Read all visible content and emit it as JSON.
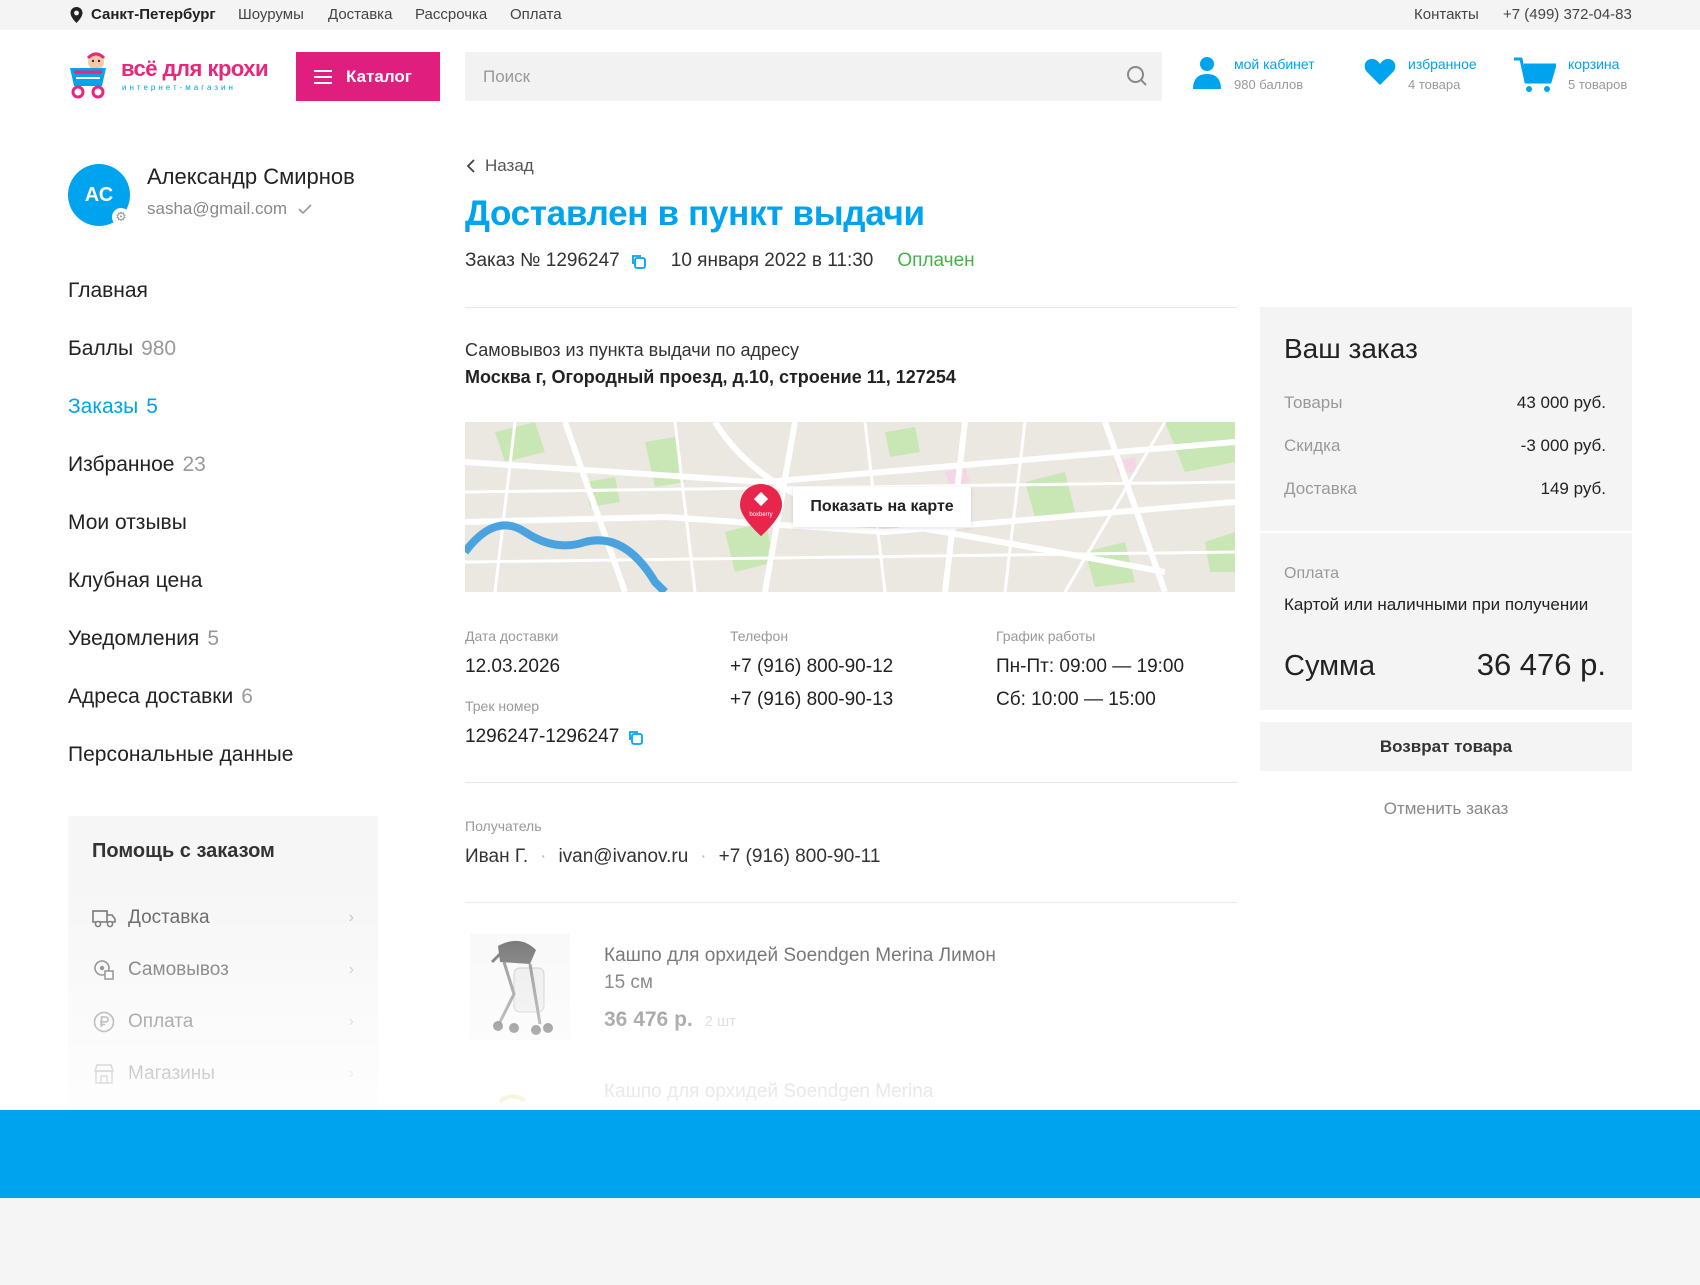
{
  "topbar": {
    "city": "Санкт-Петербург",
    "links": [
      "Шоурумы",
      "Доставка",
      "Рассрочка",
      "Оплата"
    ],
    "contacts": "Контакты",
    "phone": "+7 (499) 372-04-83"
  },
  "header": {
    "logo_text": "всё для крохи",
    "logo_sub": "интернет-магазин",
    "catalog_label": "Каталог",
    "search_placeholder": "Поиск",
    "cabinet": {
      "title": "мой кабинет",
      "sub": "980 баллов"
    },
    "favorites": {
      "title": "избранное",
      "sub": "4 товара"
    },
    "cart": {
      "title": "корзина",
      "sub": "5 товаров"
    }
  },
  "user": {
    "initials": "АС",
    "name": "Александр Смирнов",
    "email": "sasha@gmail.com"
  },
  "nav": [
    {
      "label": "Главная",
      "count": ""
    },
    {
      "label": "Баллы",
      "count": "980"
    },
    {
      "label": "Заказы",
      "count": "5",
      "active": true
    },
    {
      "label": "Избранное",
      "count": "23"
    },
    {
      "label": "Мои отзывы",
      "count": ""
    },
    {
      "label": "Клубная цена",
      "count": ""
    },
    {
      "label": "Уведомления",
      "count": "5"
    },
    {
      "label": "Адреса доставки",
      "count": "6"
    },
    {
      "label": "Персональные данные",
      "count": ""
    }
  ],
  "help": {
    "title": "Помощь с заказом",
    "items": [
      {
        "label": "Доставка",
        "icon": "truck-icon"
      },
      {
        "label": "Самовывоз",
        "icon": "pickup-icon"
      },
      {
        "label": "Оплата",
        "icon": "ruble-icon"
      },
      {
        "label": "Магазины",
        "icon": "store-icon"
      }
    ]
  },
  "order": {
    "back": "Назад",
    "status": "Доставлен в пункт выдачи",
    "number": "Заказ № 1296247",
    "date": "10 января 2022 в 11:30",
    "payment_status": "Оплачен",
    "pickup_label": "Самовывоз из пункта выдачи по адресу",
    "pickup_address": "Москва г, Огородный проезд, д.10, строение 11, 127254",
    "map_button": "Показать на карте",
    "map_pin_label": "boxberry",
    "delivery_date_label": "Дата доставки",
    "delivery_date": "12.03.2026",
    "track_label": "Трек номер",
    "track": "1296247-1296247",
    "phone_label": "Телефон",
    "phones": [
      "+7 (916) 800-90-12",
      "+7 (916) 800-90-13"
    ],
    "schedule_label": "График работы",
    "schedule": [
      "Пн-Пт: 09:00 — 19:00",
      "Сб: 10:00 — 15:00"
    ],
    "recipient_label": "Получатель",
    "recipient_name": "Иван Г.",
    "recipient_email": "ivan@ivanov.ru",
    "recipient_phone": "+7 (916) 800-90-11",
    "items": [
      {
        "name": "Кашпо для орхидей Soendgen Merina Лимон 15 см",
        "price": "36 476 р.",
        "qty": "2 шт"
      },
      {
        "name": "Кашпо для орхидей Soendgen Merina"
      }
    ]
  },
  "summary": {
    "title": "Ваш заказ",
    "rows": [
      {
        "label": "Товары",
        "value": "43 000 руб."
      },
      {
        "label": "Скидка",
        "value": "-3 000 руб."
      },
      {
        "label": "Доставка",
        "value": "149 руб."
      }
    ],
    "payment_label": "Оплата",
    "payment_value": "Картой или наличными при получении",
    "total_label": "Сумма",
    "total_value": "36 476 р.",
    "return_button": "Возврат товара",
    "cancel_button": "Отменить заказ"
  },
  "colors": {
    "accent": "#00a3ee",
    "brand_pink": "#e01e7e",
    "paid": "#47b04b"
  }
}
